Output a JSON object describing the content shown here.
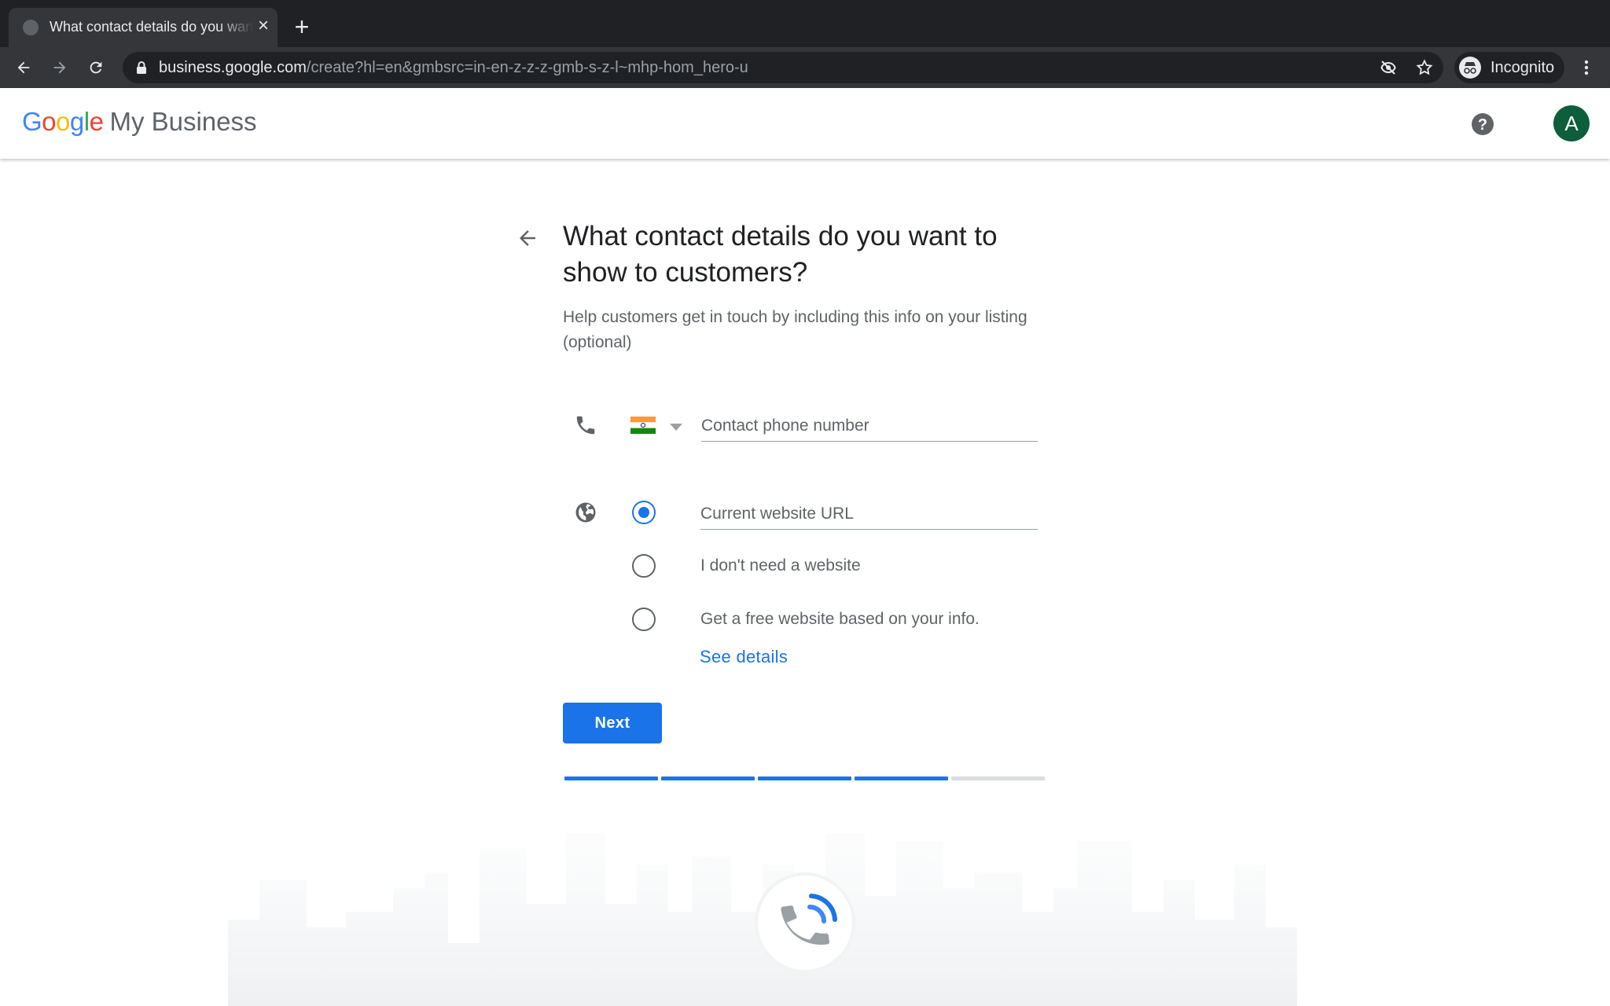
{
  "browser": {
    "tab_title": "What contact details do you want to show to customers?",
    "tab_close": "×",
    "new_tab": "+",
    "url_host": "business.google.com",
    "url_path": "/create?hl=en&gmbsrc=in-en-z-z-z-gmb-s-z-l~mhp-hom_hero-u",
    "incognito_label": "Incognito"
  },
  "header": {
    "logo_g1": "G",
    "logo_o1": "o",
    "logo_o2": "o",
    "logo_g2": "g",
    "logo_l": "l",
    "logo_e": "e",
    "product_name": "My Business",
    "avatar_initial": "A"
  },
  "form": {
    "heading": "What contact details do you want to show to customers?",
    "subtext": "Help customers get in touch by including this info on your listing (optional)",
    "phone_placeholder": "Contact phone number",
    "phone_value": "",
    "website_options": [
      {
        "label": "Current website URL",
        "selected": true
      },
      {
        "label": "I don't need a website",
        "selected": false
      },
      {
        "label": "Get a free website based on your info.",
        "selected": false
      }
    ],
    "see_details": "See details",
    "next_label": "Next"
  },
  "progress": {
    "completed_steps": 4,
    "total_steps": 5
  },
  "colors": {
    "accent": "#1a73e8",
    "avatar_bg": "#0d5e3a"
  }
}
